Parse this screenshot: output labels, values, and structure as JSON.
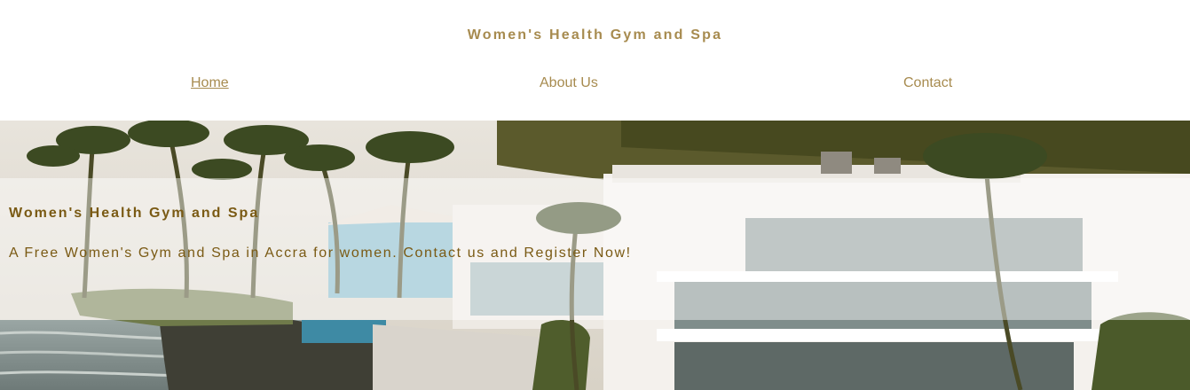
{
  "site": {
    "title": "Women's Health Gym and Spa"
  },
  "nav": {
    "items": [
      {
        "label": "Home",
        "active": true
      },
      {
        "label": "About Us",
        "active": false
      },
      {
        "label": "Contact",
        "active": false
      }
    ]
  },
  "hero": {
    "title": "Women's Health Gym and Spa",
    "subtitle": "A Free Women's Gym and Spa in Accra for women. Contact us and Register Now!"
  },
  "colors": {
    "accent": "#a78b4f",
    "hero_text": "#7a5a14"
  }
}
